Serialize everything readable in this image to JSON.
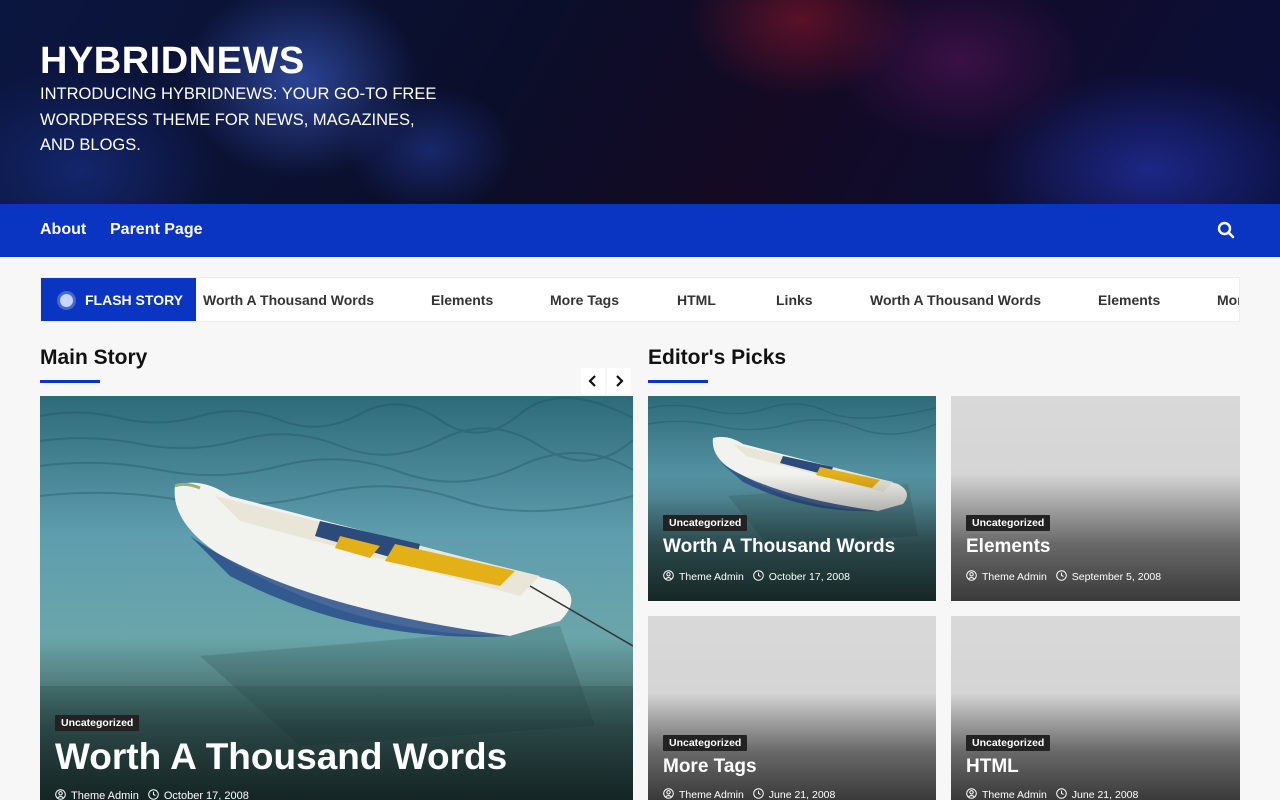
{
  "header": {
    "site_title": "HYBRIDNEWS",
    "tagline": "INTRODUCING HYBRIDNEWS: YOUR GO-TO FREE WORDPRESS THEME FOR NEWS, MAGAZINES, AND BLOGS."
  },
  "nav": {
    "items": [
      {
        "label": "About"
      },
      {
        "label": "Parent Page"
      }
    ],
    "search_icon": "search-icon"
  },
  "ticker": {
    "label": "FLASH STORY",
    "items": [
      "Worth A Thousand Words",
      "Elements",
      "More Tags",
      "HTML",
      "Links",
      "Worth A Thousand Words",
      "Elements",
      "More Tags"
    ]
  },
  "main_story": {
    "section_title": "Main Story",
    "prev_icon": "chevron-left-icon",
    "next_icon": "chevron-right-icon",
    "card": {
      "category": "Uncategorized",
      "title": "Worth A Thousand Words",
      "author": "Theme Admin",
      "date": "October 17, 2008"
    }
  },
  "editors_picks": {
    "section_title": "Editor's Picks",
    "cards": [
      {
        "category": "Uncategorized",
        "title": "Worth A Thousand Words",
        "author": "Theme Admin",
        "date": "October 17, 2008"
      },
      {
        "category": "Uncategorized",
        "title": "Elements",
        "author": "Theme Admin",
        "date": "September 5, 2008"
      },
      {
        "category": "Uncategorized",
        "title": "More Tags",
        "author": "Theme Admin",
        "date": "June 21, 2008"
      },
      {
        "category": "Uncategorized",
        "title": "HTML",
        "author": "Theme Admin",
        "date": "June 21, 2008"
      }
    ]
  },
  "colors": {
    "accent": "#0a34c2",
    "badge": "#222222",
    "page_bg": "#f7f7f7"
  }
}
